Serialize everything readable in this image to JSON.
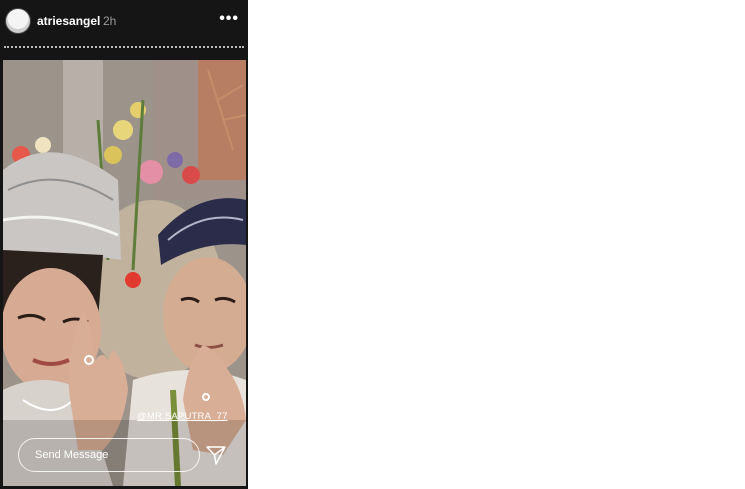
{
  "story": {
    "username": "atriesangel",
    "time_ago": "2h",
    "more_icon": "•••",
    "mention": "@MR.SAPUTRA_77",
    "reply_placeholder": "Send Message",
    "icons": {
      "avatar": "avatar",
      "more": "more-options-icon",
      "send": "paper-plane-icon"
    }
  }
}
